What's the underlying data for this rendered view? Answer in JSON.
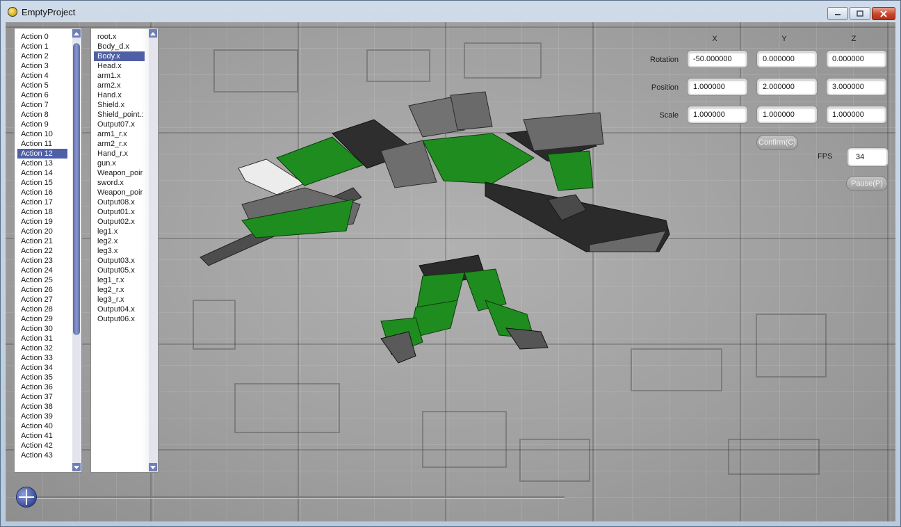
{
  "window": {
    "title": "EmptyProject",
    "minimize_label": "–",
    "maximize_label": "▢",
    "close_label": "✕"
  },
  "actions_list": {
    "items": [
      "Action 0",
      "Action 1",
      "Action 2",
      "Action 3",
      "Action 4",
      "Action 5",
      "Action 6",
      "Action 7",
      "Action 8",
      "Action 9",
      "Action 10",
      "Action 11",
      "Action 12",
      "Action 13",
      "Action 14",
      "Action 15",
      "Action 16",
      "Action 17",
      "Action 18",
      "Action 19",
      "Action 20",
      "Action 21",
      "Action 22",
      "Action 23",
      "Action 24",
      "Action 25",
      "Action 26",
      "Action 27",
      "Action 28",
      "Action 29",
      "Action 30",
      "Action 31",
      "Action 32",
      "Action 33",
      "Action 34",
      "Action 35",
      "Action 36",
      "Action 37",
      "Action 38",
      "Action 39",
      "Action 40",
      "Action 41",
      "Action 42",
      "Action 43"
    ],
    "selected": "Action 12"
  },
  "files_list": {
    "items": [
      "root.x",
      "Body_d.x",
      "Body.x",
      "Head.x",
      "arm1.x",
      "arm2.x",
      "Hand.x",
      "Shield.x",
      "Shield_point.:",
      "Output07.x",
      "arm1_r.x",
      "arm2_r.x",
      "Hand_r.x",
      "gun.x",
      "Weapon_poir",
      "sword.x",
      "Weapon_poir",
      "Output08.x",
      "Output01.x",
      "Output02.x",
      "leg1.x",
      "leg2.x",
      "leg3.x",
      "Output03.x",
      "Output05.x",
      "leg1_r.x",
      "leg2_r.x",
      "leg3_r.x",
      "Output04.x",
      "Output06.x"
    ],
    "selected": "Body.x"
  },
  "transform": {
    "headers": {
      "x": "X",
      "y": "Y",
      "z": "Z"
    },
    "rotation": {
      "label": "Rotation",
      "x": "-50.000000",
      "y": "0.000000",
      "z": "0.000000"
    },
    "position": {
      "label": "Position",
      "x": "1.000000",
      "y": "2.000000",
      "z": "3.000000"
    },
    "scale": {
      "label": "Scale",
      "x": "1.000000",
      "y": "1.000000",
      "z": "1.000000"
    },
    "confirm_label": "Confirm(C)"
  },
  "playback": {
    "fps_label": "FPS",
    "fps_value": "34",
    "pause_label": "Pause(P)",
    "timeline_position": 0
  },
  "colors": {
    "selection": "#4e5fa6",
    "robot_green": "#1f8c1f",
    "robot_gray": "#6e6e6e"
  }
}
